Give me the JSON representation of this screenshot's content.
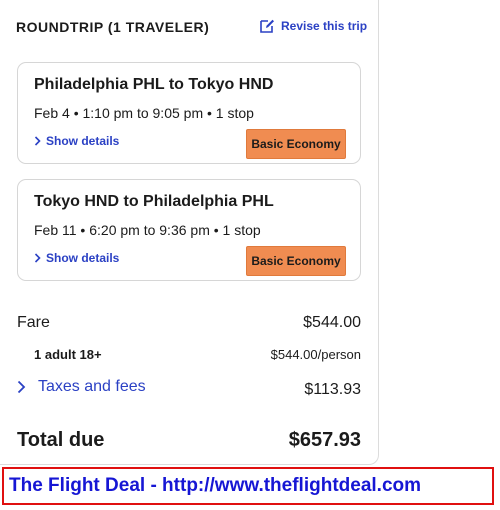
{
  "summary": {
    "title": "ROUNDTRIP (1 TRAVELER)",
    "revise_label": "Revise this trip"
  },
  "flights": [
    {
      "route": "Philadelphia PHL to Tokyo HND",
      "schedule": "Feb 4 • 1:10 pm to 9:05 pm • 1 stop",
      "details_label": "Show details",
      "fare_class": "Basic Economy"
    },
    {
      "route": "Tokyo HND to Philadelphia PHL",
      "schedule": "Feb 11 • 6:20 pm to 9:36 pm • 1 stop",
      "details_label": "Show details",
      "fare_class": "Basic Economy"
    }
  ],
  "pricing": {
    "fare_label": "Fare",
    "fare_value": "$544.00",
    "adult_label": "1 adult 18+",
    "adult_value": "$544.00/person",
    "taxes_label": "Taxes and fees",
    "taxes_value": "$113.93",
    "total_label": "Total due",
    "total_value": "$657.93"
  },
  "banner": {
    "text": "The Flight Deal - http://www.theflightdeal.com"
  },
  "colors": {
    "link": "#2b41c4",
    "badge": "#f08c51",
    "banner_border": "#e01010",
    "banner_text": "#1616d4"
  }
}
